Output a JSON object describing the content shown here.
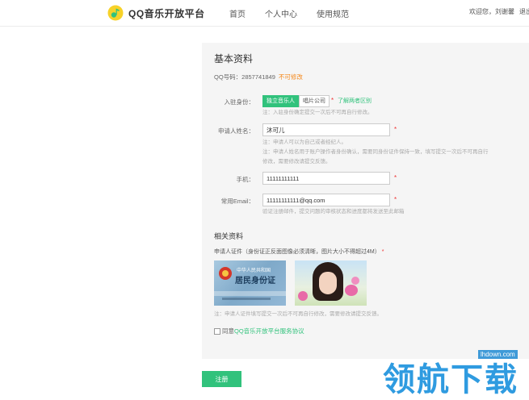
{
  "header": {
    "logo_text": "QQ音乐开放平台",
    "nav": {
      "home": "首页",
      "personal": "个人中心",
      "rules": "使用规范"
    },
    "greeting": "欢迎您，刘谢馨",
    "logout": "退出"
  },
  "basic": {
    "title": "基本资料",
    "qq_label": "QQ号码：2857741849",
    "qq_warn": "不可修改",
    "identity": {
      "label": "入驻身份：",
      "option_active": "独立音乐人",
      "option_inactive": "唱片公司",
      "link": "了解两者区别",
      "note": "注：入驻身份确定提交一次后不可再自行修改。"
    },
    "name": {
      "label": "申请人姓名：",
      "value": "沐可儿",
      "note1": "注：申请人可以为自己或者经纪人。",
      "note2": "注：申请人姓名用于账户操作者身份确认，需要同身份证件保持一致，填写提交一次后不可再自行",
      "note3": "修改，需要修改请提交反馈。"
    },
    "phone": {
      "label": "手机：",
      "value": "11111111111"
    },
    "email": {
      "label": "常用Email：",
      "value": "11111111111@qq.com",
      "note": "验证注册邮件，提交问题的审核状态和进度都将发送至此邮箱"
    },
    "required_mark": "*"
  },
  "related": {
    "title": "相关资料",
    "cert_label": "申请人证件（身份证正反面图像必须清晰，图片大小不得超过4M）",
    "idcard": {
      "line1": "中华人民共和国",
      "line2": "居民身份证"
    },
    "note": "注：申请人证件填写提交一次后不可再自行修改，需要修改请提交反馈。",
    "agree_prefix": "同意",
    "agree_link": "QQ音乐开放平台服务协议"
  },
  "submit_label": "注册",
  "watermark": {
    "url": "lhdown.com",
    "text": "领航下载"
  },
  "colors": {
    "accent": "#31c27c",
    "warn": "#f58a1e",
    "required": "#e33333"
  }
}
